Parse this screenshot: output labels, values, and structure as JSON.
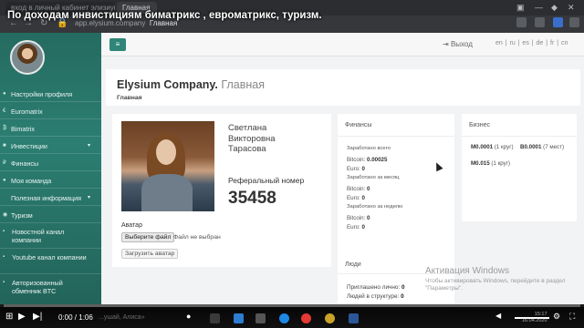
{
  "video": {
    "title": "По доходам инвистициям биматрикс , евроматрикс, туризм.",
    "time_current": "0:00",
    "time_total": "1:06",
    "progress": 0.0,
    "search_placeholder": "...ушай, Алиса»",
    "clock_time": "15:17",
    "clock_date": "16.04.2020"
  },
  "browser": {
    "inactive_tab": "вход в личный кабинет элизиум к...",
    "active_tab": "Главная",
    "url_domain": "app.elysium.company",
    "url_page": "Главная"
  },
  "sidebar": {
    "items": [
      {
        "icon": "gear-icon",
        "label": "Настройки профиля"
      },
      {
        "icon": "euro-icon",
        "label": "Euromatrix"
      },
      {
        "icon": "bitcoin-icon",
        "label": "Bimatrix"
      },
      {
        "icon": "cart-icon",
        "label": "Инвестиции"
      },
      {
        "icon": "ruble-icon",
        "label": "Финансы"
      },
      {
        "icon": "team-icon",
        "label": "Моя команда"
      },
      {
        "icon": "",
        "label": "Полезная информация"
      },
      {
        "icon": "globe-icon",
        "label": "Туризм"
      },
      {
        "icon": "",
        "label": "Новостной канал компании"
      },
      {
        "icon": "",
        "label": "Youtube канал компании"
      },
      {
        "icon": "",
        "label": "Авторизованный обменник BTC"
      }
    ]
  },
  "topbar": {
    "logout": "Выход",
    "languages": "en | ru | es | de | fr | cn"
  },
  "header": {
    "company": "Elysium Company.",
    "page": "Главная",
    "breadcrumb": "Главная"
  },
  "profile": {
    "name_line1": "Светлана",
    "name_line2": "Викторовна",
    "name_line3": "Тарасова",
    "ref_label": "Реферальный номер",
    "ref_number": "35458",
    "avatar_label": "Аватар",
    "choose_file": "Выберите файл",
    "no_file": "Файл не выбран",
    "upload": "Загрузить аватар"
  },
  "finance": {
    "heading": "Финансы",
    "total_label": "Заработано всего",
    "total_btc_label": "Bitcoin:",
    "total_btc": "0.00025",
    "total_eur_label": "Euro:",
    "total_eur": "0",
    "month_label": "Заработано за месяц",
    "month_btc_label": "Bitcoin:",
    "month_btc": "0",
    "month_eur_label": "Euro:",
    "month_eur": "0",
    "week_label": "Заработано за неделю",
    "week_btc_label": "Bitcoin:",
    "week_btc": "0",
    "week_eur_label": "Euro:",
    "week_eur": "0"
  },
  "business": {
    "heading": "Бизнес",
    "m1_label": "M0.0001",
    "m1_detail": "(1 круг)",
    "m2_label": "M0.015",
    "m2_detail": "(1 круг)",
    "b1_label": "B0.0001",
    "b1_detail": "(7 мест)"
  },
  "people": {
    "heading": "Люди",
    "invited_label": "Приглашено лично:",
    "invited": "0",
    "structure_label": "Людей в структуре:",
    "structure": "0"
  },
  "watermark": {
    "line1": "Активация Windows",
    "line2": "Чтобы активировать Windows, перейдите в раздел \"Параметры\"."
  }
}
